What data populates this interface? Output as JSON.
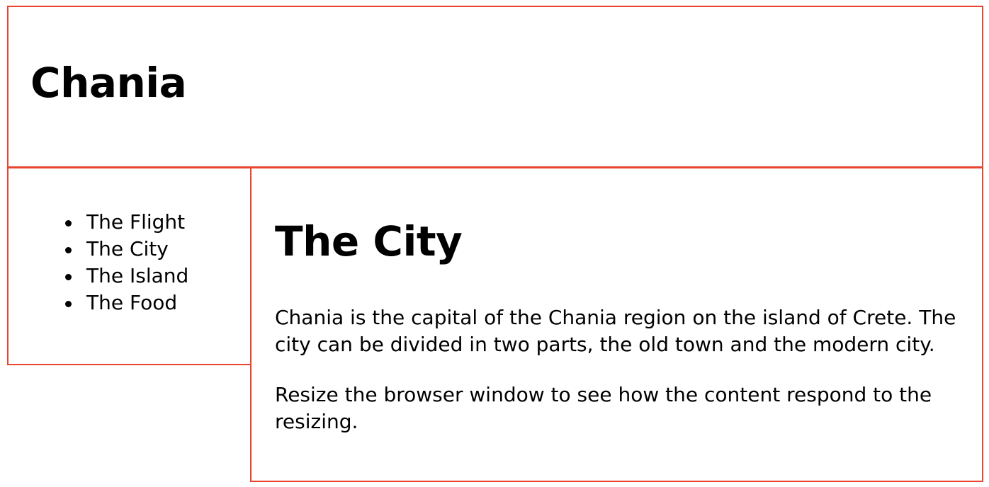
{
  "header": {
    "title": "Chania"
  },
  "menu": {
    "items": [
      {
        "label": "The Flight"
      },
      {
        "label": "The City"
      },
      {
        "label": "The Island"
      },
      {
        "label": "The Food"
      }
    ]
  },
  "main": {
    "heading": "The City",
    "paragraphs": [
      "Chania is the capital of the Chania region on the island of Crete. The city can be divided in two parts, the old town and the modern city.",
      "Resize the browser window to see how the content respond to the resizing."
    ]
  },
  "colors": {
    "border": "#e8442e",
    "background": "#ffffff",
    "text": "#000000"
  }
}
